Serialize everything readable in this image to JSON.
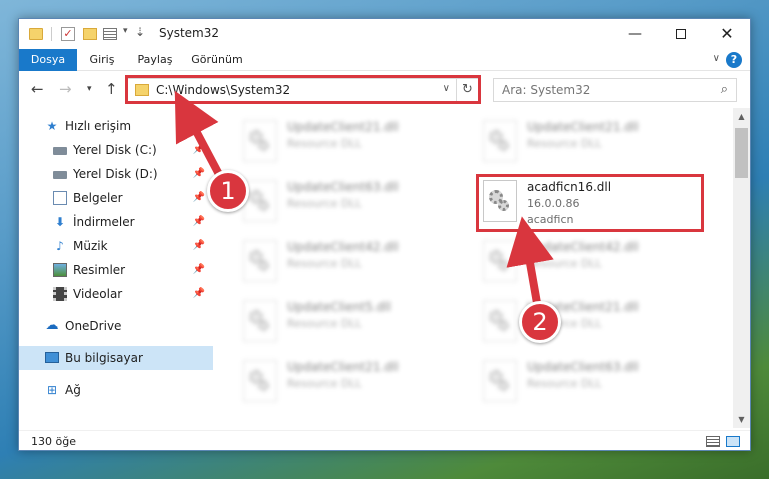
{
  "window": {
    "title": "System32",
    "minimize_glyph": "—",
    "close_glyph": "✕"
  },
  "ribbon": {
    "tabs": [
      "Dosya",
      "Giriş",
      "Paylaş",
      "Görünüm"
    ],
    "active_tab": "Dosya",
    "help_label": "?"
  },
  "navigation": {
    "address": "C:\\Windows\\System32",
    "search_placeholder": "Ara: System32"
  },
  "sidebar": {
    "items": [
      {
        "label": "Hızlı erişim",
        "icon": "star-icon",
        "pinned": false
      },
      {
        "label": "Yerel Disk (C:)",
        "icon": "drive-icon",
        "pinned": true
      },
      {
        "label": "Yerel Disk (D:)",
        "icon": "drive-icon",
        "pinned": true
      },
      {
        "label": "Belgeler",
        "icon": "documents-icon",
        "pinned": true
      },
      {
        "label": "İndirmeler",
        "icon": "download-icon",
        "pinned": true
      },
      {
        "label": "Müzik",
        "icon": "music-icon",
        "pinned": true
      },
      {
        "label": "Resimler",
        "icon": "pictures-icon",
        "pinned": true
      },
      {
        "label": "Videolar",
        "icon": "videos-icon",
        "pinned": true
      },
      {
        "label": "OneDrive",
        "icon": "cloud-icon",
        "pinned": false
      },
      {
        "label": "Bu bilgisayar",
        "icon": "computer-icon",
        "pinned": false,
        "selected": true
      },
      {
        "label": "Ağ",
        "icon": "network-icon",
        "pinned": false
      }
    ]
  },
  "files": {
    "left_column": [
      {
        "name": "UpdateClient21.dll",
        "type": "Resource DLL"
      },
      {
        "name": "UpdateClient63.dll",
        "type": "Resource DLL"
      },
      {
        "name": "UpdateClient42.dll",
        "type": "Resource DLL"
      },
      {
        "name": "UpdateClient5.dll",
        "type": "Resource DLL"
      },
      {
        "name": "UpdateClient21.dll",
        "type": "Resource DLL"
      }
    ],
    "right_column": [
      {
        "name": "UpdateClient21.dll",
        "type": "Resource DLL"
      },
      {
        "name": "UpdateClient42.dll",
        "type": "Resource DLL"
      },
      {
        "name": "UpdateClient21.dll",
        "type": "Resource DLL"
      },
      {
        "name": "UpdateClient63.dll",
        "type": "Resource DLL"
      }
    ],
    "highlighted": {
      "name": "acadficn16.dll",
      "version": "16.0.0.86",
      "description": "acadficn"
    }
  },
  "status": {
    "item_count": "130 öğe"
  },
  "annotations": {
    "step_1": "1",
    "step_2": "2",
    "color": "#d9363e"
  }
}
